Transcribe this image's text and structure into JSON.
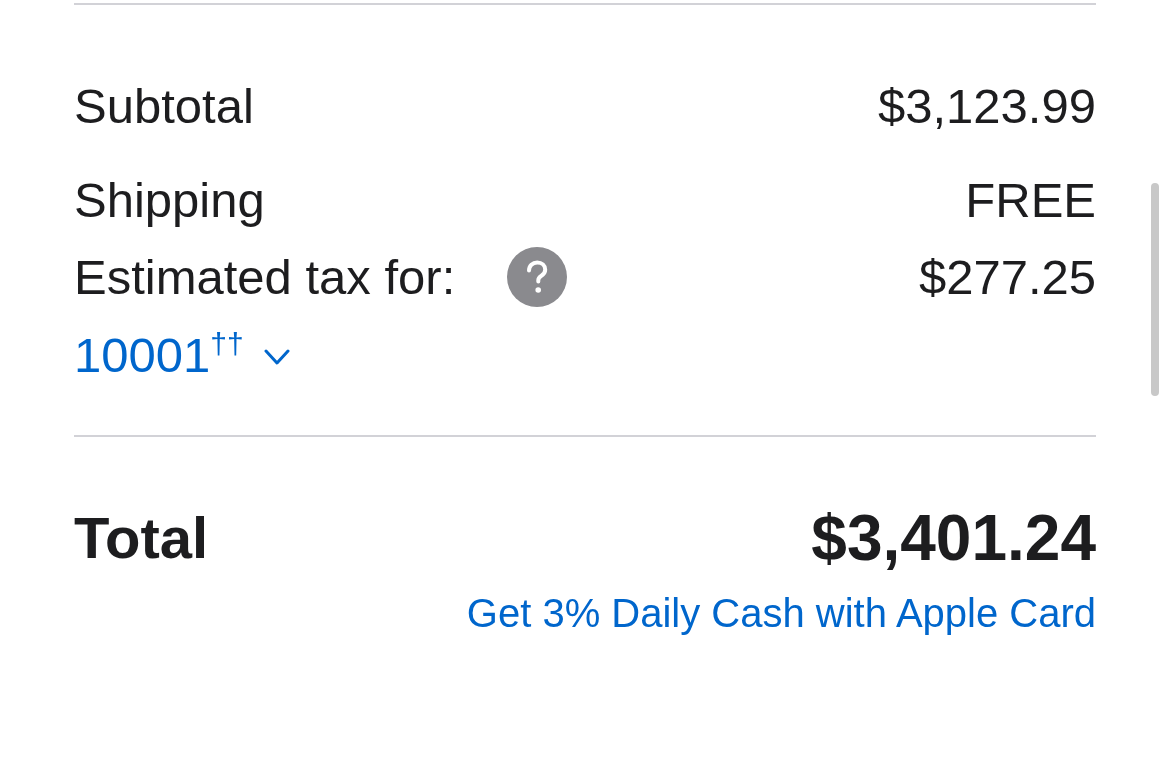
{
  "order_summary": {
    "lines": [
      {
        "label": "Subtotal",
        "value": "$3,123.99",
        "help": false
      },
      {
        "label": "Shipping",
        "value": "FREE",
        "help": false
      },
      {
        "label": "Estimated tax for:",
        "value": "$277.25",
        "help": true
      }
    ],
    "zip_code": "10001$^{††}$",
    "total": {
      "label": "Total",
      "value": "$3,401.24"
    },
    "apple_card_link": "Get 3% Daily Cash with Apple Card"
  }
}
